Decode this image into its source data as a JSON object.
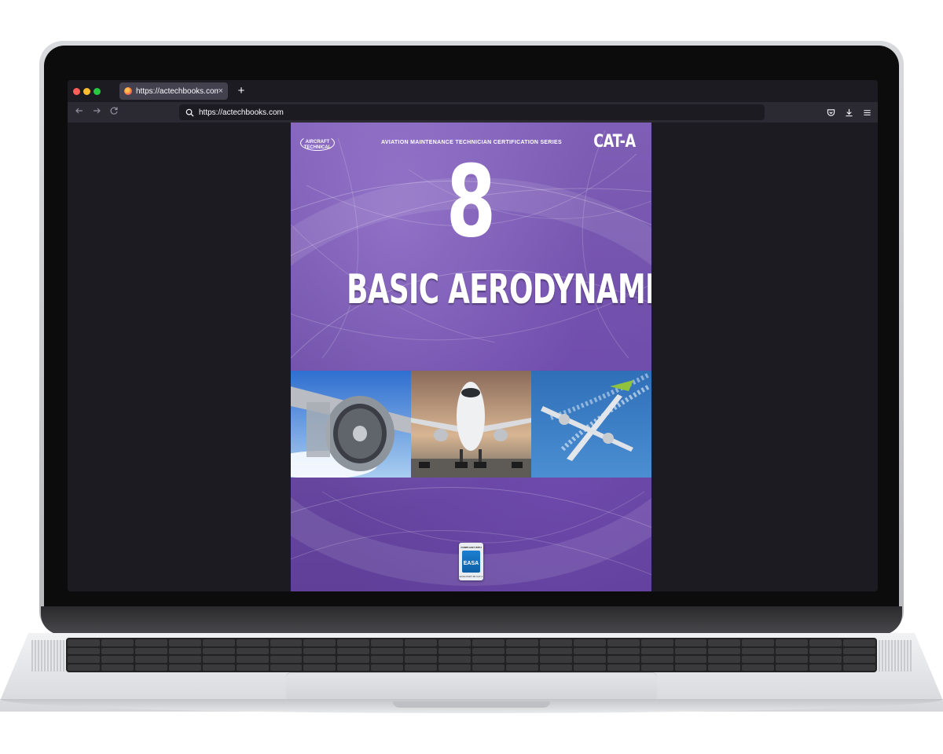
{
  "browser": {
    "tab": {
      "title": "https://actechbooks.com",
      "close_glyph": "×"
    },
    "new_tab_glyph": "+",
    "url": "https://actechbooks.com",
    "icons": [
      "back-arrow-icon",
      "forward-arrow-icon",
      "reload-icon",
      "search-icon",
      "pocket-icon",
      "download-icon",
      "hamburger-menu-icon"
    ]
  },
  "cover": {
    "publisher_logo": "AIRCRAFT TECHNICAL",
    "series": "AVIATION MAINTENANCE TECHNICIAN CERTIFICATION SERIES",
    "category": "CAT-A",
    "module_number": "8",
    "title": "BASIC AERODYNAMICS",
    "photos": [
      "jet-engine-photo",
      "jumbo-jet-front-photo",
      "turboprop-in-flight-photo"
    ],
    "badge": {
      "top": "COMPLIANT WITH",
      "name": "EASA",
      "bottom": "EASA PART-66 CAT A"
    },
    "colors": {
      "background": "#6f4fa9"
    }
  }
}
